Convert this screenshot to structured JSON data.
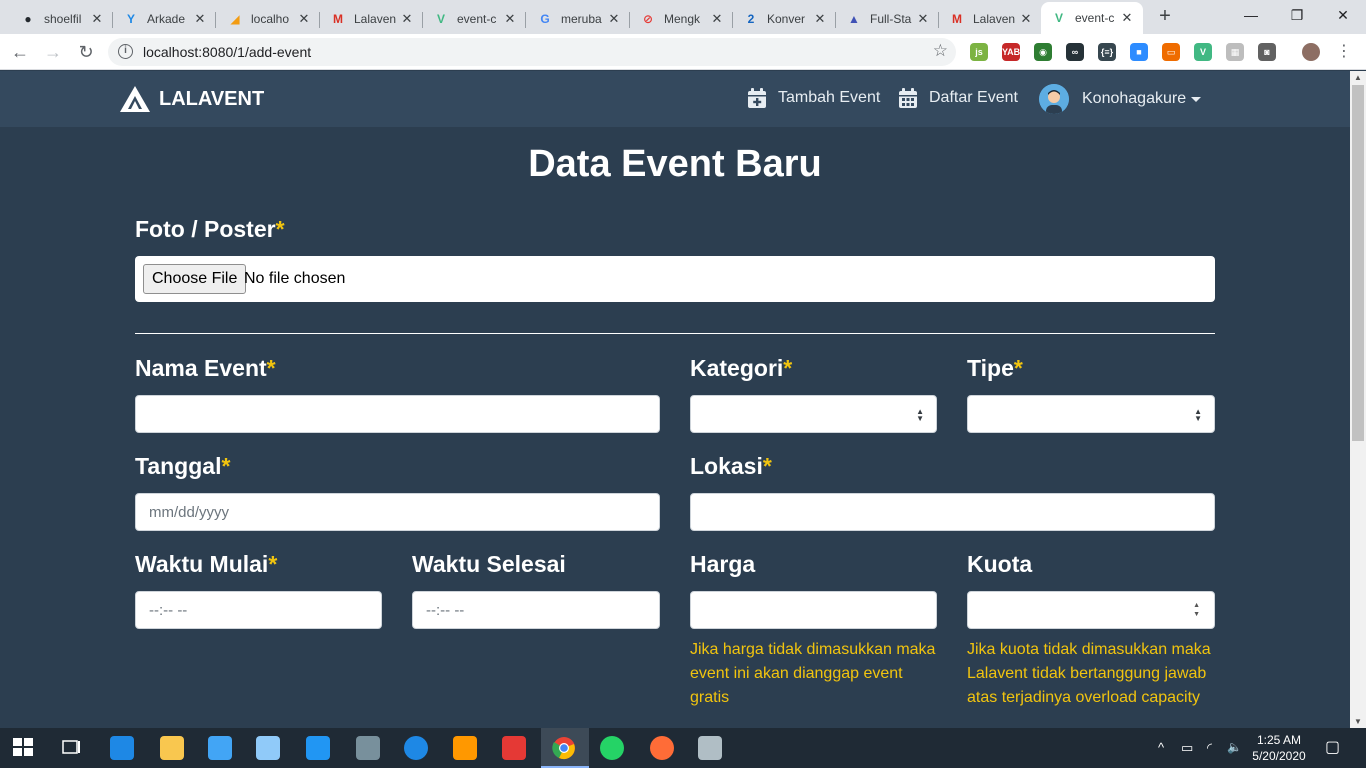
{
  "browser": {
    "tabs": [
      {
        "label": "shoelfil",
        "favicon": "github-icon",
        "color": "#24292e",
        "glyph": "●"
      },
      {
        "label": "Arkade",
        "favicon": "arkademy-icon",
        "color": "#1e88e5",
        "glyph": "Y"
      },
      {
        "label": "localho",
        "favicon": "phpmyadmin-icon",
        "color": "#f39c12",
        "glyph": "◢"
      },
      {
        "label": "Lalaven",
        "favicon": "gmail-icon",
        "color": "#d93025",
        "glyph": "M"
      },
      {
        "label": "event-c",
        "favicon": "vue-icon",
        "color": "#41b883",
        "glyph": "V"
      },
      {
        "label": "meruba",
        "favicon": "google-icon",
        "color": "#4285f4",
        "glyph": "G"
      },
      {
        "label": "Mengk",
        "favicon": "stop-icon",
        "color": "#e53935",
        "glyph": "⊘"
      },
      {
        "label": "Konver",
        "favicon": "konversi-icon",
        "color": "#1565c0",
        "glyph": "2"
      },
      {
        "label": "Full-Sta",
        "favicon": "fullstack-icon",
        "color": "#3f51b5",
        "glyph": "▲"
      },
      {
        "label": "Lalaven",
        "favicon": "gmail-icon",
        "color": "#d93025",
        "glyph": "M"
      },
      {
        "label": "event-c",
        "favicon": "vue-icon",
        "color": "#41b883",
        "glyph": "V"
      }
    ],
    "new_tab": "+",
    "window": {
      "minimize": "—",
      "maximize": "❐",
      "close": "✕"
    },
    "nav": {
      "back": "←",
      "forward": "→",
      "reload": "↻"
    },
    "url": "localhost:8080/1/add-event",
    "url_info": "i",
    "bookmark": "☆",
    "menu": "⋮",
    "extensions": [
      {
        "name": "nodejs-ext-icon",
        "color": "#7cb342",
        "glyph": "js"
      },
      {
        "name": "yab-ext-icon",
        "color": "#c62828",
        "glyph": "YAB"
      },
      {
        "name": "globe-ext-icon",
        "color": "#2e7d32",
        "glyph": "◉"
      },
      {
        "name": "incognito-ext-icon",
        "color": "#263238",
        "glyph": "∞"
      },
      {
        "name": "json-ext-icon",
        "color": "#37474f",
        "glyph": "{≡}"
      },
      {
        "name": "zoom-ext-icon",
        "color": "#2d8cff",
        "glyph": "■"
      },
      {
        "name": "notes-ext-icon",
        "color": "#ef6c00",
        "glyph": "▭"
      },
      {
        "name": "vue-devtools-icon",
        "color": "#41b883",
        "glyph": "V"
      },
      {
        "name": "grid-ext-icon",
        "color": "#bdbdbd",
        "glyph": "▦"
      },
      {
        "name": "camera-ext-icon",
        "color": "#616161",
        "glyph": "◙"
      }
    ]
  },
  "navbar": {
    "brand": "LALAVENT",
    "links": [
      {
        "label": "Tambah Event",
        "icon": "calendar-plus-icon"
      },
      {
        "label": "Daftar Event",
        "icon": "calendar-icon"
      }
    ],
    "user": "Konohagakure"
  },
  "form": {
    "title": "Data Event Baru",
    "required_mark": "*",
    "photo": {
      "label": "Foto / Poster",
      "button": "Choose File",
      "status": "No file chosen"
    },
    "name": {
      "label": "Nama Event"
    },
    "category": {
      "label": "Kategori"
    },
    "type": {
      "label": "Tipe"
    },
    "date": {
      "label": "Tanggal",
      "placeholder": "mm/dd/yyyy"
    },
    "location": {
      "label": "Lokasi"
    },
    "start_time": {
      "label": "Waktu Mulai",
      "placeholder": "--:-- --"
    },
    "end_time": {
      "label": "Waktu Selesai",
      "placeholder": "--:-- --"
    },
    "price": {
      "label": "Harga",
      "hint": "Jika harga tidak dimasukkan maka event ini akan dianggap event gratis"
    },
    "quota": {
      "label": "Kuota",
      "hint": "Jika kuota tidak dimasukkan maka Lalavent tidak bertanggung jawab atas terjadinya overload capacity"
    }
  },
  "taskbar": {
    "apps": [
      {
        "name": "windows-start-icon",
        "color": "#ffffff"
      },
      {
        "name": "task-view-icon",
        "color": "#ffffff"
      },
      {
        "name": "edge-icon",
        "color": "#1e88e5"
      },
      {
        "name": "file-explorer-icon",
        "color": "#f9c74f"
      },
      {
        "name": "mail-icon",
        "color": "#42a5f5"
      },
      {
        "name": "network-app-icon",
        "color": "#90caf9"
      },
      {
        "name": "vscode-icon",
        "color": "#2196f3"
      },
      {
        "name": "devices-icon",
        "color": "#78909c"
      },
      {
        "name": "app-blue-icon",
        "color": "#1e88e5"
      },
      {
        "name": "sublime-icon",
        "color": "#ff9800"
      },
      {
        "name": "photo-app-icon",
        "color": "#e53935"
      },
      {
        "name": "chrome-icon",
        "color": "#fbbc04"
      },
      {
        "name": "whatsapp-icon",
        "color": "#25d366"
      },
      {
        "name": "postman-icon",
        "color": "#ff6c37"
      },
      {
        "name": "paint-icon",
        "color": "#b0bec5"
      }
    ],
    "tray": {
      "chevron": "^",
      "battery": "▭",
      "wifi": "◜",
      "volume": "🔈",
      "notifications": "▢"
    },
    "time": "1:25 AM",
    "date": "5/20/2020"
  }
}
